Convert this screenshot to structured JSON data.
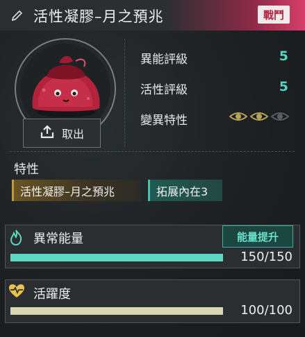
{
  "header": {
    "title": "活性凝膠–月之預兆",
    "badge": "戰鬥"
  },
  "take_button_label": "取出",
  "stats": [
    {
      "label": "異能評級",
      "value": "5"
    },
    {
      "label": "活性評級",
      "value": "5"
    },
    {
      "label": "變異特性",
      "eyes_active": 2,
      "eyes_total": 3
    }
  ],
  "traits": {
    "title": "特性",
    "tags": [
      "活性凝膠–月之預兆",
      "拓展內在3"
    ]
  },
  "energy": {
    "label": "異常能量",
    "boost_label": "能量提升",
    "current": 150,
    "max": 150,
    "value_text": "150/150",
    "color": "#5fd7c2"
  },
  "vitality": {
    "label": "活躍度",
    "current": 100,
    "max": 100,
    "value_text": "100/100",
    "color": "#d9d7b4"
  },
  "colors": {
    "accent_teal": "#52d6c0",
    "badge_red": "#b0243f",
    "eye_gold": "#b8a35a"
  },
  "icons": [
    "edit-icon",
    "upload-icon",
    "eye-icon",
    "flame-icon",
    "heart-pulse-icon"
  ]
}
